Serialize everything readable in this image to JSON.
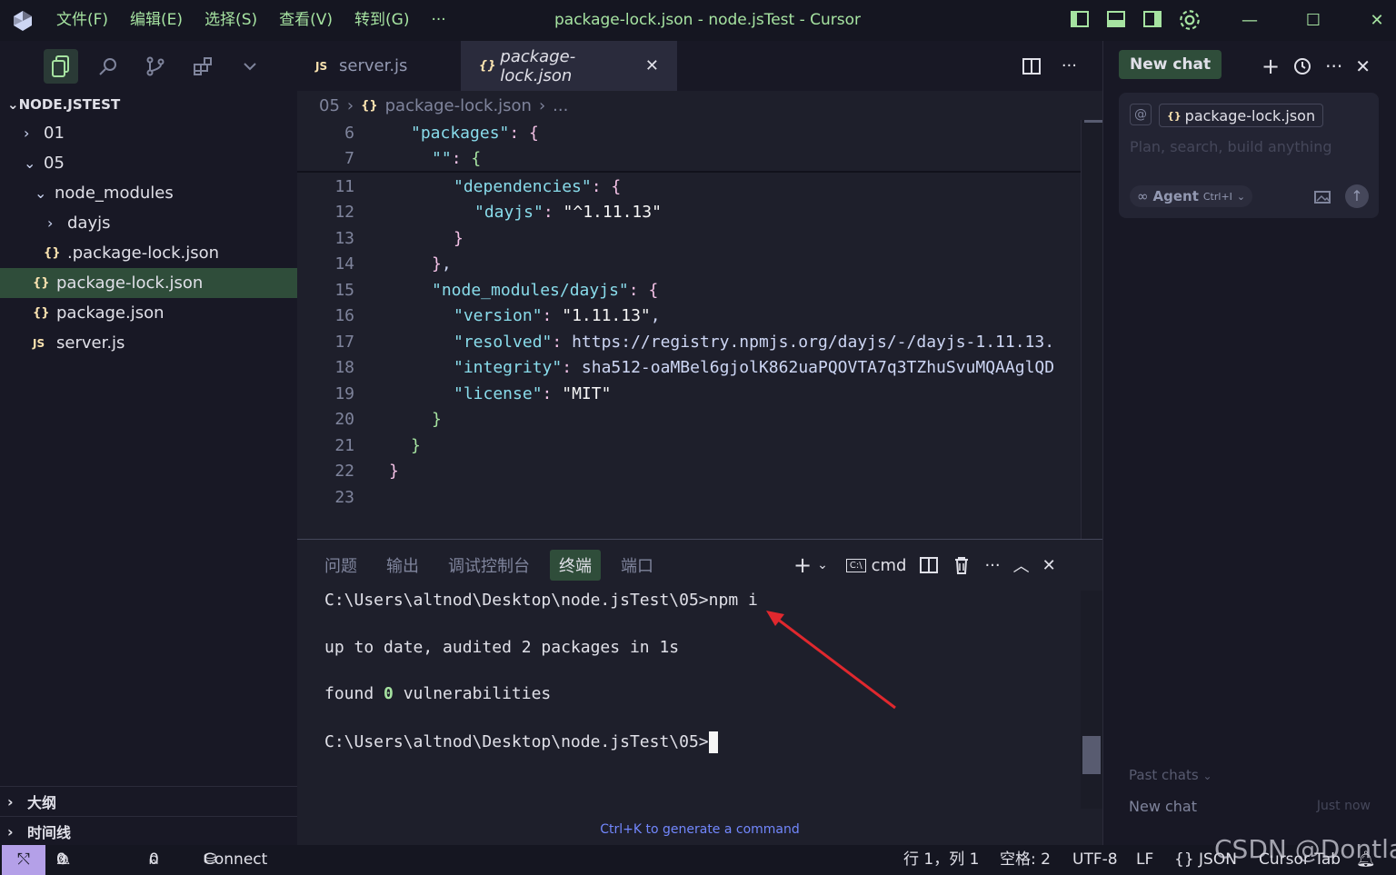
{
  "window": {
    "title": "package-lock.json - node.jsTest - Cursor",
    "menu": [
      "文件(F)",
      "编辑(E)",
      "选择(S)",
      "查看(V)",
      "转到(G)",
      "···"
    ]
  },
  "explorer": {
    "header": "NODE.JSTEST",
    "items": [
      {
        "label": "01"
      },
      {
        "label": "05"
      },
      {
        "label": "node_modules"
      },
      {
        "label": "dayjs"
      },
      {
        "label": ".package-lock.json"
      },
      {
        "label": "package-lock.json"
      },
      {
        "label": "package.json"
      },
      {
        "label": "server.js"
      }
    ],
    "outline": "大纲",
    "timeline": "时间线"
  },
  "editor": {
    "tabs": [
      {
        "label": "server.js",
        "icon": "JS"
      },
      {
        "label": "package-lock.json",
        "icon": "{}"
      }
    ],
    "breadcrumb": {
      "folder": "05",
      "file": "package-lock.json",
      "more": "..."
    },
    "sticky": [
      {
        "line": "6",
        "text": "\"packages\": {"
      },
      {
        "line": "7",
        "text": "\"\": {"
      }
    ],
    "lines": [
      {
        "line": "11",
        "text": "\"dependencies\": {"
      },
      {
        "line": "12",
        "text": "\"dayjs\": \"^1.11.13\""
      },
      {
        "line": "13",
        "text": "}"
      },
      {
        "line": "14",
        "text": "},"
      },
      {
        "line": "15",
        "text": "\"node_modules/dayjs\": {"
      },
      {
        "line": "16",
        "text": "\"version\": \"1.11.13\","
      },
      {
        "line": "17",
        "text": "\"resolved\": \"https://registry.npmjs.org/dayjs/-/dayjs-1.11.13."
      },
      {
        "line": "18",
        "text": "\"integrity\": \"sha512-oaMBel6gjolK862uaPQOVTA7q3TZhuSvuMQAAglQD"
      },
      {
        "line": "19",
        "text": "\"license\": \"MIT\""
      },
      {
        "line": "20",
        "text": "}"
      },
      {
        "line": "21",
        "text": "}"
      },
      {
        "line": "22",
        "text": "}"
      },
      {
        "line": "23",
        "text": ""
      }
    ]
  },
  "panel": {
    "tabs": [
      "问题",
      "输出",
      "调试控制台",
      "终端",
      "端口"
    ],
    "shell": "cmd",
    "terminal": [
      "C:\\Users\\altnod\\Desktop\\node.jsTest\\05>npm i",
      "up to date, audited 2 packages in 1s",
      "found 0 vulnerabilities",
      "C:\\Users\\altnod\\Desktop\\node.jsTest\\05>"
    ],
    "vuln_prefix": "found ",
    "vuln_count": "0",
    "vuln_suffix": " vulnerabilities",
    "hint": "Ctrl+K to generate a command"
  },
  "chat": {
    "new_chat": "New chat",
    "context_chip": "package-lock.json",
    "placeholder": "Plan, search, build anything",
    "mode": "Agent",
    "mode_shortcut": "Ctrl+I",
    "past_chats": "Past chats",
    "history": [
      {
        "title": "New chat",
        "time": "Just now"
      }
    ]
  },
  "status": {
    "errors": "0",
    "warnings": "0",
    "ports": "0",
    "connect": "Connect",
    "position": "行 1，列 1",
    "spaces": "空格: 2",
    "encoding": "UTF-8",
    "eol": "LF",
    "language": "{} JSON",
    "cursor_tab": "Cursor Tab"
  },
  "watermark": "CSDN @Dontla"
}
